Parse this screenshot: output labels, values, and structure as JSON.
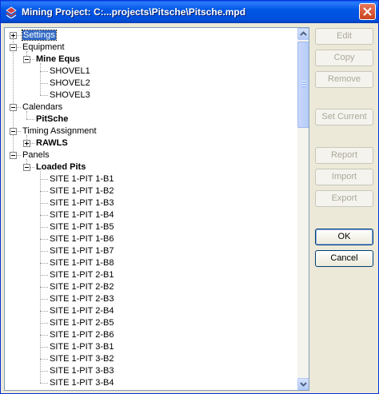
{
  "window": {
    "title": "Mining Project: C:...projects\\Pitsche\\Pitsche.mpd"
  },
  "tree": {
    "nodes": [
      {
        "label": "Settings",
        "level": 0,
        "expander": "plus",
        "bold": false,
        "selected": true
      },
      {
        "label": "Equipment",
        "level": 0,
        "expander": "minus",
        "bold": false
      },
      {
        "label": "Mine Equs",
        "level": 1,
        "expander": "minus",
        "bold": true
      },
      {
        "label": "SHOVEL1",
        "level": 2,
        "expander": null,
        "bold": false
      },
      {
        "label": "SHOVEL2",
        "level": 2,
        "expander": null,
        "bold": false
      },
      {
        "label": "SHOVEL3",
        "level": 2,
        "expander": null,
        "bold": false
      },
      {
        "label": "Calendars",
        "level": 0,
        "expander": "minus",
        "bold": false
      },
      {
        "label": "PitSche",
        "level": 1,
        "expander": null,
        "bold": true
      },
      {
        "label": "Timing Assignment",
        "level": 0,
        "expander": "minus",
        "bold": false
      },
      {
        "label": "RAWLS",
        "level": 1,
        "expander": "plus",
        "bold": true
      },
      {
        "label": "Panels",
        "level": 0,
        "expander": "minus",
        "bold": false
      },
      {
        "label": "Loaded Pits",
        "level": 1,
        "expander": "minus",
        "bold": true
      },
      {
        "label": "SITE 1-PIT 1-B1",
        "level": 2,
        "expander": null,
        "bold": false
      },
      {
        "label": "SITE 1-PIT 1-B2",
        "level": 2,
        "expander": null,
        "bold": false
      },
      {
        "label": "SITE 1-PIT 1-B3",
        "level": 2,
        "expander": null,
        "bold": false
      },
      {
        "label": "SITE 1-PIT 1-B4",
        "level": 2,
        "expander": null,
        "bold": false
      },
      {
        "label": "SITE 1-PIT 1-B5",
        "level": 2,
        "expander": null,
        "bold": false
      },
      {
        "label": "SITE 1-PIT 1-B6",
        "level": 2,
        "expander": null,
        "bold": false
      },
      {
        "label": "SITE 1-PIT 1-B7",
        "level": 2,
        "expander": null,
        "bold": false
      },
      {
        "label": "SITE 1-PIT 1-B8",
        "level": 2,
        "expander": null,
        "bold": false
      },
      {
        "label": "SITE 1-PIT 2-B1",
        "level": 2,
        "expander": null,
        "bold": false
      },
      {
        "label": "SITE 1-PIT 2-B2",
        "level": 2,
        "expander": null,
        "bold": false
      },
      {
        "label": "SITE 1-PIT 2-B3",
        "level": 2,
        "expander": null,
        "bold": false
      },
      {
        "label": "SITE 1-PIT 2-B4",
        "level": 2,
        "expander": null,
        "bold": false
      },
      {
        "label": "SITE 1-PIT 2-B5",
        "level": 2,
        "expander": null,
        "bold": false
      },
      {
        "label": "SITE 1-PIT 2-B6",
        "level": 2,
        "expander": null,
        "bold": false
      },
      {
        "label": "SITE 1-PIT 3-B1",
        "level": 2,
        "expander": null,
        "bold": false
      },
      {
        "label": "SITE 1-PIT 3-B2",
        "level": 2,
        "expander": null,
        "bold": false
      },
      {
        "label": "SITE 1-PIT 3-B3",
        "level": 2,
        "expander": null,
        "bold": false
      },
      {
        "label": "SITE 1-PIT 3-B4",
        "level": 2,
        "expander": null,
        "bold": false
      }
    ]
  },
  "buttons": {
    "edit": {
      "label": "Edit",
      "enabled": false
    },
    "copy": {
      "label": "Copy",
      "enabled": false
    },
    "remove": {
      "label": "Remove",
      "enabled": false
    },
    "set_current": {
      "label": "Set Current",
      "enabled": false
    },
    "report": {
      "label": "Report",
      "enabled": false
    },
    "import": {
      "label": "Import",
      "enabled": false
    },
    "export": {
      "label": "Export",
      "enabled": false
    },
    "ok": {
      "label": "OK",
      "enabled": true
    },
    "cancel": {
      "label": "Cancel",
      "enabled": true
    }
  },
  "colors": {
    "titlebar": "#0054e3",
    "selection": "#316ac5",
    "disabled_text": "#aca899"
  }
}
